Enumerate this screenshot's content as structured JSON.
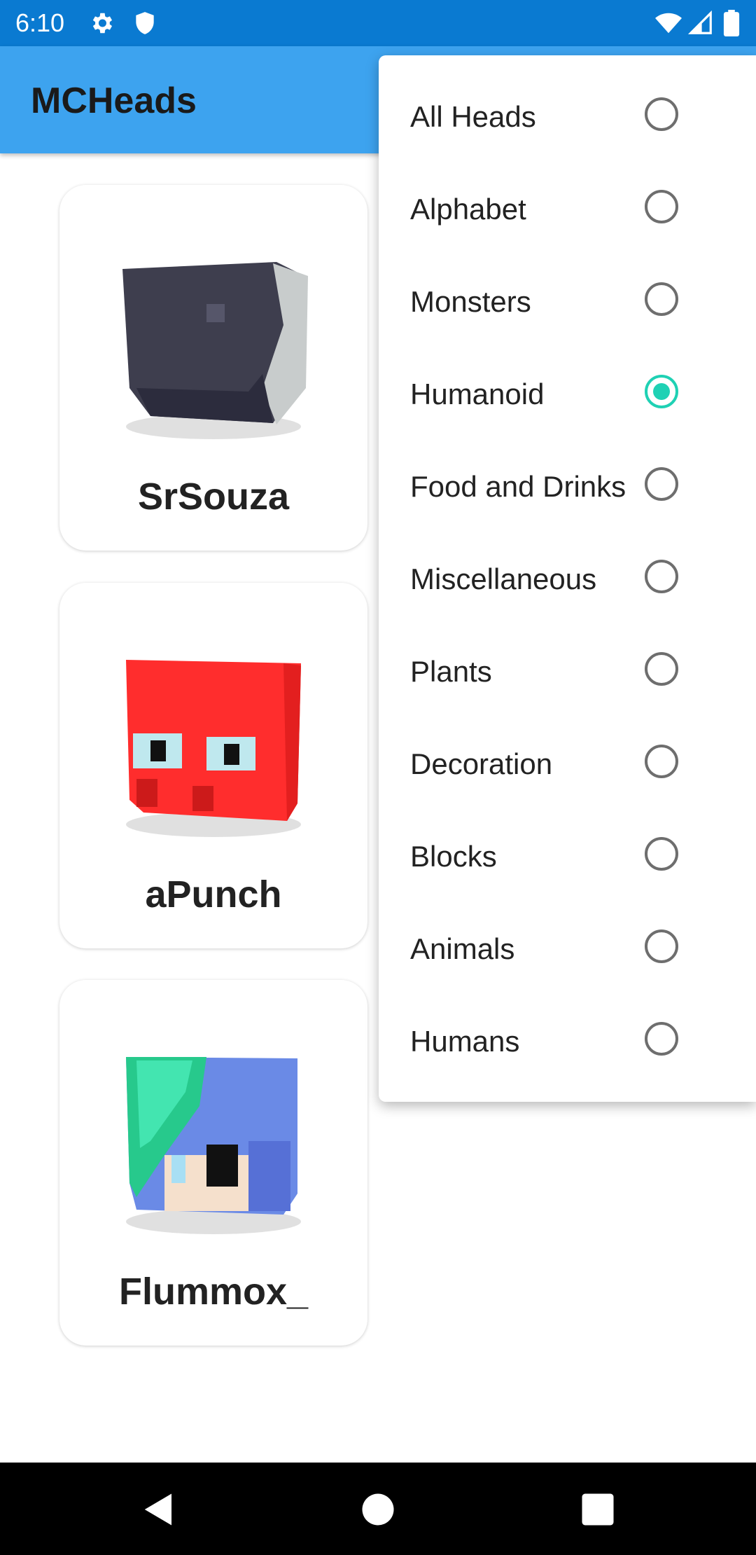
{
  "status": {
    "time": "6:10",
    "left_icons": [
      "gear-icon",
      "shield-icon"
    ],
    "right_icons": [
      "wifi-icon",
      "signal-icon",
      "battery-icon"
    ],
    "color": "#0a7ad1"
  },
  "app_bar": {
    "title": "MCHeads",
    "color": "#3da3ef"
  },
  "cards": [
    {
      "name": "SrSouza",
      "head_icon": "dark-gray-helmet-head"
    },
    {
      "name": "aPunch",
      "head_icon": "red-octopus-head"
    },
    {
      "name": "Flummox_",
      "head_icon": "blue-green-haired-head"
    }
  ],
  "menu": {
    "items": [
      {
        "label": "All Heads",
        "selected": false
      },
      {
        "label": "Alphabet",
        "selected": false
      },
      {
        "label": "Monsters",
        "selected": false
      },
      {
        "label": "Humanoid",
        "selected": true
      },
      {
        "label": "Food and Drinks",
        "selected": false
      },
      {
        "label": "Miscellaneous",
        "selected": false
      },
      {
        "label": "Plants",
        "selected": false
      },
      {
        "label": "Decoration",
        "selected": false
      },
      {
        "label": "Blocks",
        "selected": false
      },
      {
        "label": "Animals",
        "selected": false
      },
      {
        "label": "Humans",
        "selected": false
      }
    ],
    "accent_color": "#1fd1b4"
  },
  "nav": {
    "buttons": [
      "back-icon",
      "home-icon",
      "recents-icon"
    ]
  }
}
